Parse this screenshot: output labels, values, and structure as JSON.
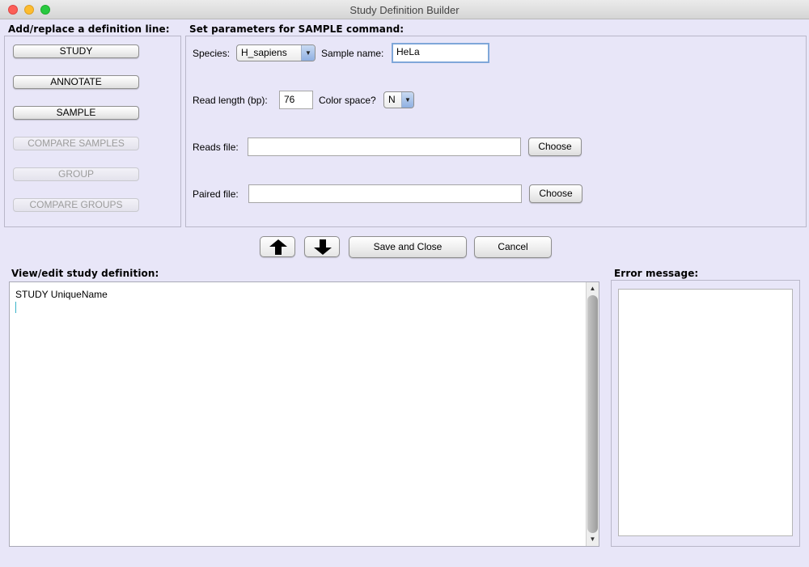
{
  "window": {
    "title": "Study Definition Builder"
  },
  "left_panel": {
    "heading": "Add/replace a definition line:",
    "buttons": [
      {
        "label": "STUDY",
        "enabled": true
      },
      {
        "label": "ANNOTATE",
        "enabled": true
      },
      {
        "label": "SAMPLE",
        "enabled": true
      },
      {
        "label": "COMPARE SAMPLES",
        "enabled": false
      },
      {
        "label": "GROUP",
        "enabled": false
      },
      {
        "label": "COMPARE GROUPS",
        "enabled": false
      }
    ]
  },
  "params_panel": {
    "heading": "Set parameters for SAMPLE command:",
    "species_label": "Species:",
    "species_value": "H_sapiens",
    "sample_name_label": "Sample name:",
    "sample_name_value": "HeLa",
    "read_length_label": "Read length (bp):",
    "read_length_value": "76",
    "color_space_label": "Color space?",
    "color_space_value": "N",
    "reads_file_label": "Reads file:",
    "reads_file_value": "",
    "paired_file_label": "Paired file:",
    "paired_file_value": "",
    "choose_label": "Choose"
  },
  "actions": {
    "save_close_label": "Save and Close",
    "cancel_label": "Cancel"
  },
  "editor": {
    "heading": "View/edit study definition:",
    "text": "STUDY UniqueName"
  },
  "error": {
    "heading": "Error message:",
    "text": ""
  }
}
